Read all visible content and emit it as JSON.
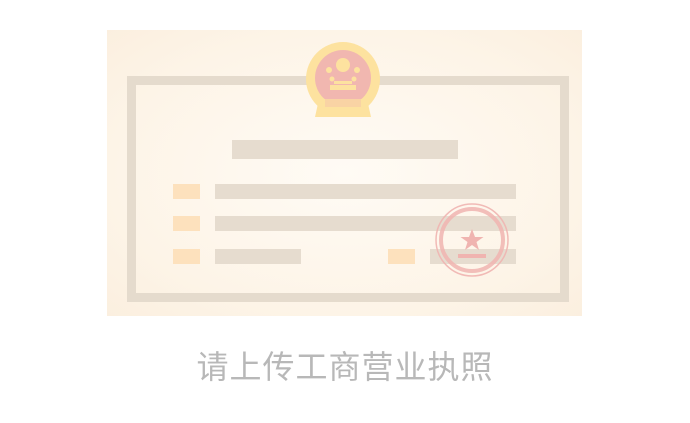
{
  "upload": {
    "caption": "请上传工商营业执照",
    "icons": {
      "emblem": "national-emblem-icon",
      "seal": "official-seal-icon"
    },
    "colors": {
      "card_background": "#fdf3e7",
      "frame": "#e5dbcd",
      "text_bar": "#e6dccf",
      "label_tag": "#fde1bd",
      "emblem_gold": "#fde29f",
      "emblem_red": "#f1b7b0",
      "seal_red": "#f0b4b0",
      "caption_text": "#b8b8b8"
    }
  }
}
